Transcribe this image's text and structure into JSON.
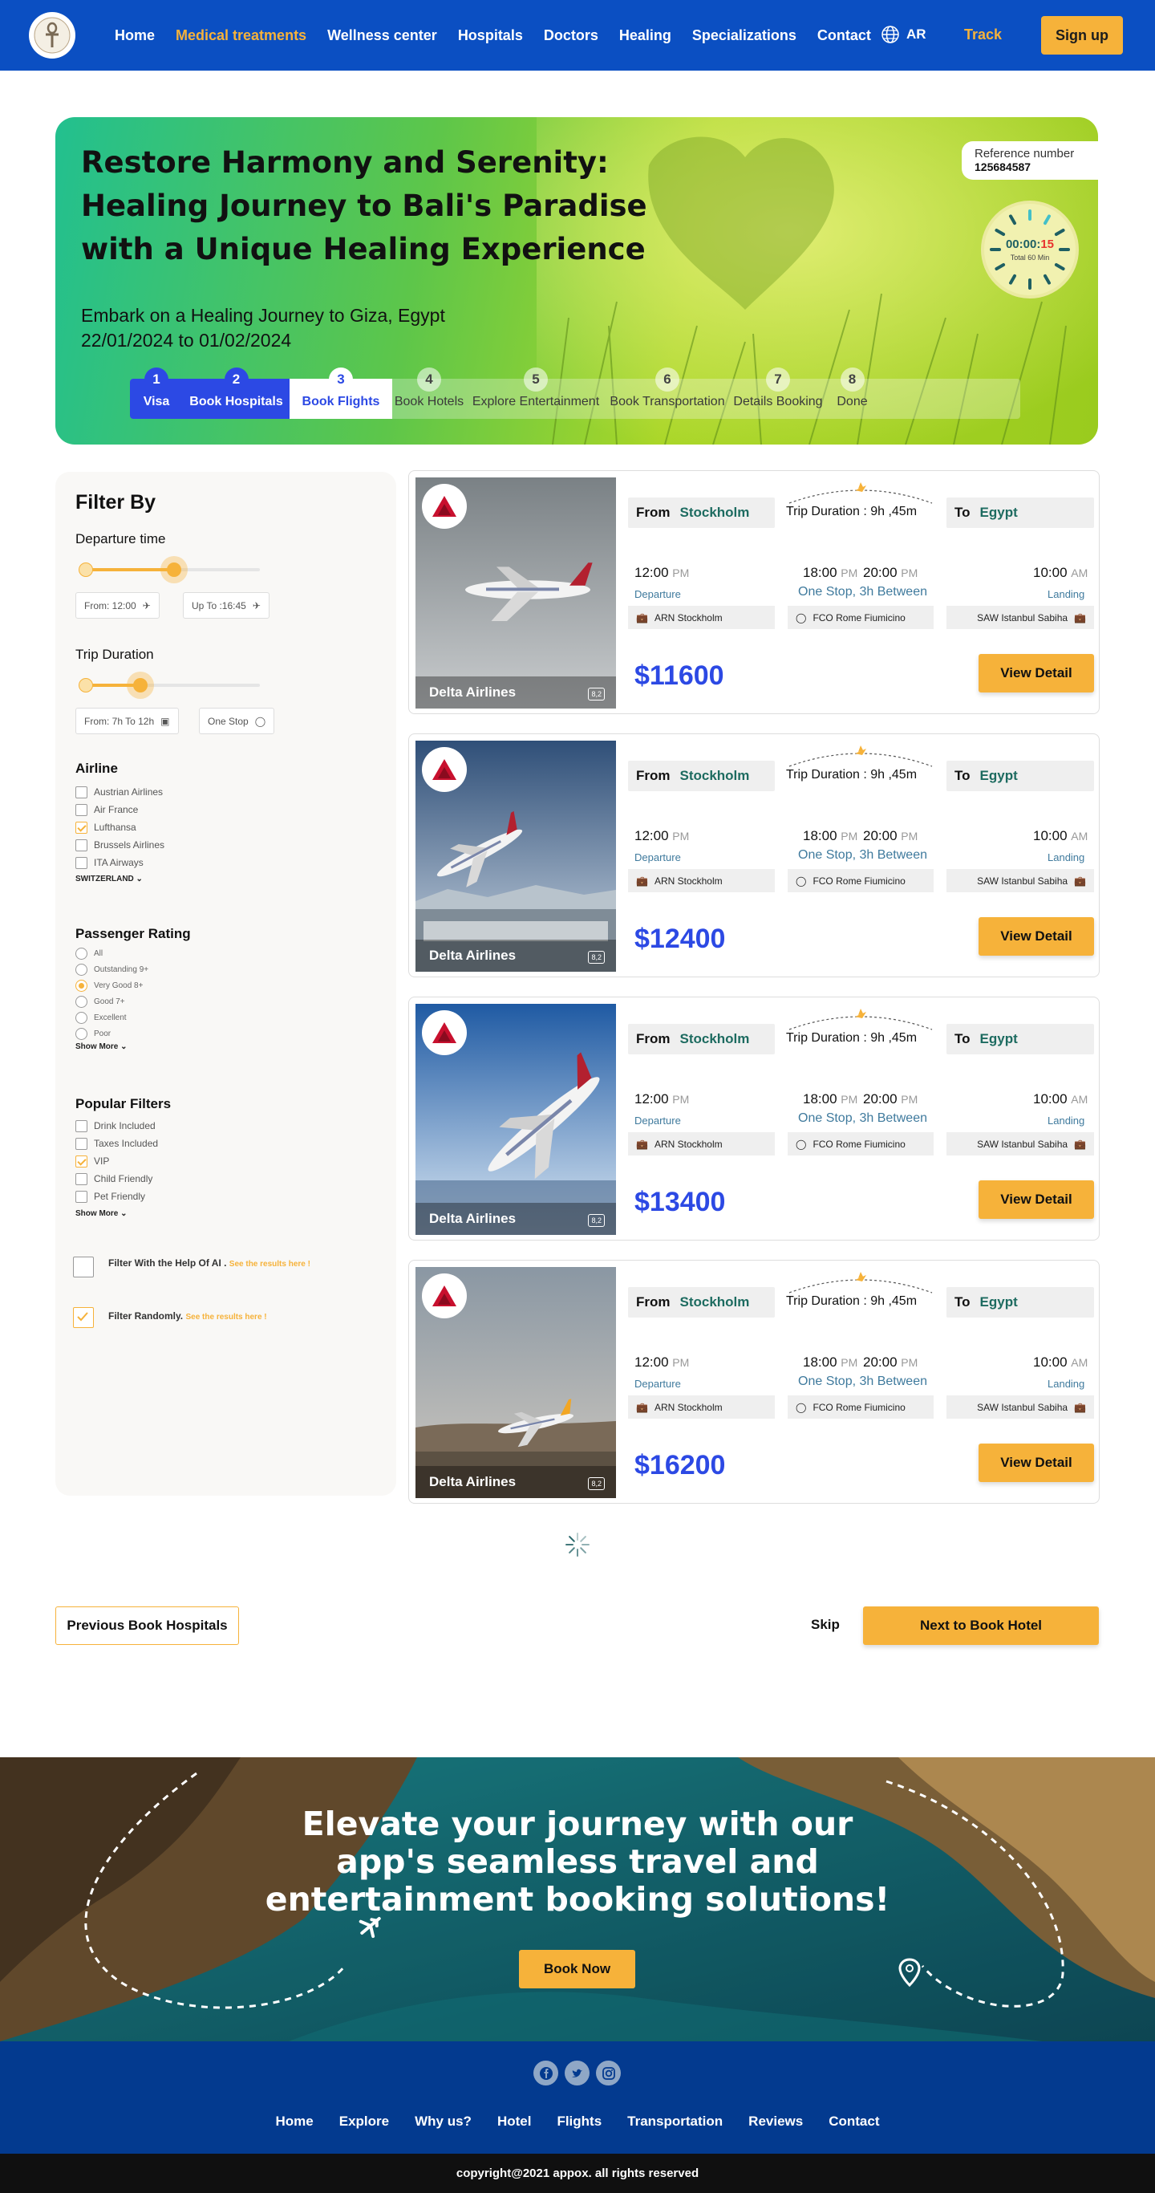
{
  "nav": {
    "links": [
      "Home",
      "Medical treatments",
      "Wellness center",
      "Hospitals",
      "Doctors",
      "Healing",
      "Specializations",
      "Contact"
    ],
    "active_index": 1,
    "lang": "AR",
    "track": "Track",
    "signup": "Sign up"
  },
  "hero": {
    "title": "Restore Harmony and Serenity: Healing Journey to Bali's Paradise with a Unique Healing Experience",
    "subtitle_line1": "Embark on a Healing Journey to Giza, Egypt",
    "subtitle_line2": "22/01/2024 to 01/02/2024",
    "ref_label": "Reference number",
    "ref_value": "125684587",
    "timer_main": "00:00:",
    "timer_sec": "15",
    "timer_sub": "Total 60 Min",
    "steps": [
      {
        "num": "1",
        "label": "Visa",
        "state": "done"
      },
      {
        "num": "2",
        "label": "Book Hospitals",
        "state": "done"
      },
      {
        "num": "3",
        "label": "Book Flights",
        "state": "current"
      },
      {
        "num": "4",
        "label": "Book Hotels",
        "state": "todo"
      },
      {
        "num": "5",
        "label": "Explore Entertainment",
        "state": "todo"
      },
      {
        "num": "6",
        "label": "Book Transportation",
        "state": "todo"
      },
      {
        "num": "7",
        "label": "Details Booking",
        "state": "todo"
      },
      {
        "num": "8",
        "label": "Done",
        "state": "todo"
      }
    ]
  },
  "filter": {
    "title": "Filter By",
    "departure": {
      "title": "Departure time",
      "from": "From: 12:00",
      "to": "Up To :16:45"
    },
    "duration": {
      "title": "Trip Duration",
      "from": "From: 7h To 12h",
      "stops": "One Stop"
    },
    "airline": {
      "title": "Airline",
      "items": [
        {
          "label": "Austrian Airlines",
          "checked": false
        },
        {
          "label": "Air France",
          "checked": false
        },
        {
          "label": "Lufthansa",
          "checked": true
        },
        {
          "label": "Brussels Airlines",
          "checked": false
        },
        {
          "label": "ITA Airways",
          "checked": false
        }
      ],
      "more": "SWITZERLAND"
    },
    "rating": {
      "title": "Passenger Rating",
      "items": [
        {
          "label": "All",
          "checked": false
        },
        {
          "label": "Outstanding 9+",
          "checked": false
        },
        {
          "label": "Very Good 8+",
          "checked": true
        },
        {
          "label": "Good 7+",
          "checked": false
        },
        {
          "label": "Excellent",
          "checked": false
        },
        {
          "label": "Poor",
          "checked": false
        }
      ],
      "more": "Show More"
    },
    "popular": {
      "title": "Popular Filters",
      "items": [
        {
          "label": "Drink Included",
          "checked": false
        },
        {
          "label": "Taxes Included",
          "checked": false
        },
        {
          "label": "VIP",
          "checked": true
        },
        {
          "label": "Child Friendly",
          "checked": false
        },
        {
          "label": "Pet Friendly",
          "checked": false
        }
      ],
      "more": "Show More"
    },
    "ai": {
      "label": "Filter With the Help Of AI .",
      "link": "See the results  here !",
      "checked": false
    },
    "random": {
      "label": "Filter Randomly.",
      "link": "See the results  here !",
      "checked": true
    }
  },
  "flights": [
    {
      "airline": "Delta Airlines",
      "rating": "8,2",
      "from_label": "From",
      "from": "Stockholm",
      "to_label": "To",
      "to": "Egypt",
      "duration": "Trip Duration  : 9h ,45m",
      "dep_time": "12:00",
      "dep_ampm": "PM",
      "stop_time1": "18:00",
      "stop_ampm1": "PM",
      "stop_time2": "20:00",
      "stop_ampm2": "PM",
      "arr_time": "10:00",
      "arr_ampm": "AM",
      "departure": "Departure",
      "stops": "One Stop, 3h Between",
      "landing": "Landing",
      "apt_from": "ARN Stockholm",
      "apt_stop": "FCO Rome Fiumicino",
      "apt_to": "SAW Istanbul Sabiha",
      "price": "$11600",
      "button": "View Detail"
    },
    {
      "airline": "Delta Airlines",
      "rating": "8,2",
      "from_label": "From",
      "from": "Stockholm",
      "to_label": "To",
      "to": "Egypt",
      "duration": "Trip Duration  : 9h ,45m",
      "dep_time": "12:00",
      "dep_ampm": "PM",
      "stop_time1": "18:00",
      "stop_ampm1": "PM",
      "stop_time2": "20:00",
      "stop_ampm2": "PM",
      "arr_time": "10:00",
      "arr_ampm": "AM",
      "departure": "Departure",
      "stops": "One Stop, 3h Between",
      "landing": "Landing",
      "apt_from": "ARN Stockholm",
      "apt_stop": "FCO Rome Fiumicino",
      "apt_to": "SAW Istanbul Sabiha",
      "price": "$12400",
      "button": "View Detail"
    },
    {
      "airline": "Delta Airlines",
      "rating": "8,2",
      "from_label": "From",
      "from": "Stockholm",
      "to_label": "To",
      "to": "Egypt",
      "duration": "Trip Duration  : 9h ,45m",
      "dep_time": "12:00",
      "dep_ampm": "PM",
      "stop_time1": "18:00",
      "stop_ampm1": "PM",
      "stop_time2": "20:00",
      "stop_ampm2": "PM",
      "arr_time": "10:00",
      "arr_ampm": "AM",
      "departure": "Departure",
      "stops": "One Stop, 3h Between",
      "landing": "Landing",
      "apt_from": "ARN Stockholm",
      "apt_stop": "FCO Rome Fiumicino",
      "apt_to": "SAW Istanbul Sabiha",
      "price": "$13400",
      "button": "View Detail"
    },
    {
      "airline": "Delta Airlines",
      "rating": "8,2",
      "from_label": "From",
      "from": "Stockholm",
      "to_label": "To",
      "to": "Egypt",
      "duration": "Trip Duration  : 9h ,45m",
      "dep_time": "12:00",
      "dep_ampm": "PM",
      "stop_time1": "18:00",
      "stop_ampm1": "PM",
      "stop_time2": "20:00",
      "stop_ampm2": "PM",
      "arr_time": "10:00",
      "arr_ampm": "AM",
      "departure": "Departure",
      "stops": "One Stop, 3h Between",
      "landing": "Landing",
      "apt_from": "ARN Stockholm",
      "apt_stop": "FCO Rome Fiumicino",
      "apt_to": "SAW Istanbul Sabiha",
      "price": "$16200",
      "button": "View Detail"
    }
  ],
  "pager": {
    "prev": "Previous Book Hospitals",
    "skip": "Skip",
    "next": "Next to Book Hotel"
  },
  "promo": {
    "title": "Elevate your journey with our app's seamless travel and entertainment booking solutions!",
    "button": "Book Now"
  },
  "footer": {
    "links": [
      "Home",
      "Explore",
      "Why us?",
      "Hotel",
      "Flights",
      "Transportation",
      "Reviews",
      "Contact"
    ],
    "social": [
      "facebook-icon",
      "twitter-icon",
      "instagram-icon"
    ],
    "copyright": "copyright@2021 appox. all rights reserved"
  },
  "colors": {
    "primary": "#0b4fc2",
    "accent": "#f6b23a",
    "price": "#2c49e4",
    "footer": "#033a8f"
  }
}
